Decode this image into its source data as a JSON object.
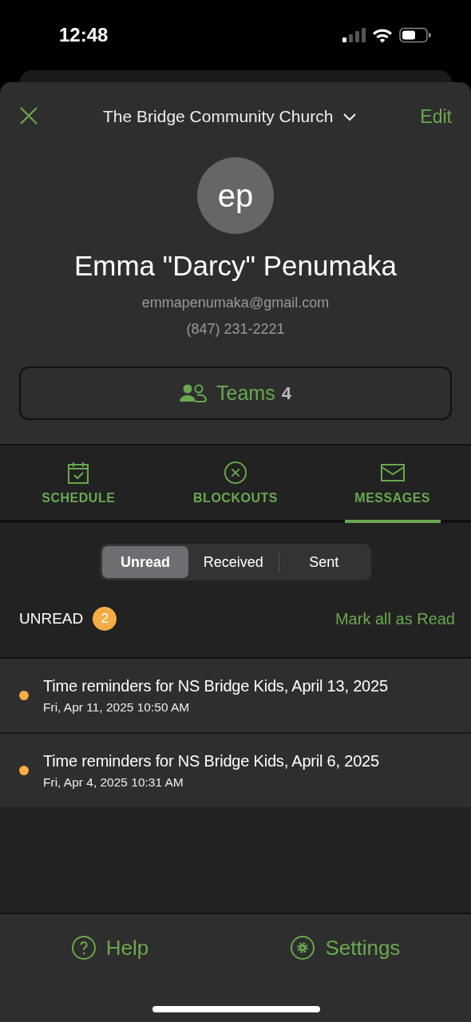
{
  "status_bar": {
    "time": "12:48"
  },
  "header": {
    "organization": "The Bridge Community Church",
    "edit": "Edit"
  },
  "profile": {
    "initials": "ep",
    "name": "Emma \"Darcy\" Penumaka",
    "email": "emmapenumaka@gmail.com",
    "phone": "(847) 231-2221"
  },
  "teams": {
    "label": "Teams",
    "count": "4"
  },
  "tabs": [
    {
      "label": "SCHEDULE",
      "selected": false
    },
    {
      "label": "BLOCKOUTS",
      "selected": false
    },
    {
      "label": "MESSAGES",
      "selected": true
    }
  ],
  "filter": [
    {
      "label": "Unread",
      "selected": true
    },
    {
      "label": "Received",
      "selected": false
    },
    {
      "label": "Sent",
      "selected": false
    }
  ],
  "section": {
    "title": "UNREAD",
    "count": "2",
    "action": "Mark all as Read"
  },
  "messages": [
    {
      "title": "Time reminders for NS Bridge Kids, April 13, 2025",
      "date": "Fri, Apr 11, 2025 10:50 AM",
      "unread": true
    },
    {
      "title": "Time reminders for NS Bridge Kids, April 6, 2025",
      "date": "Fri, Apr 4, 2025 10:31 AM",
      "unread": true
    }
  ],
  "footer": [
    {
      "label": "Help"
    },
    {
      "label": "Settings"
    }
  ]
}
